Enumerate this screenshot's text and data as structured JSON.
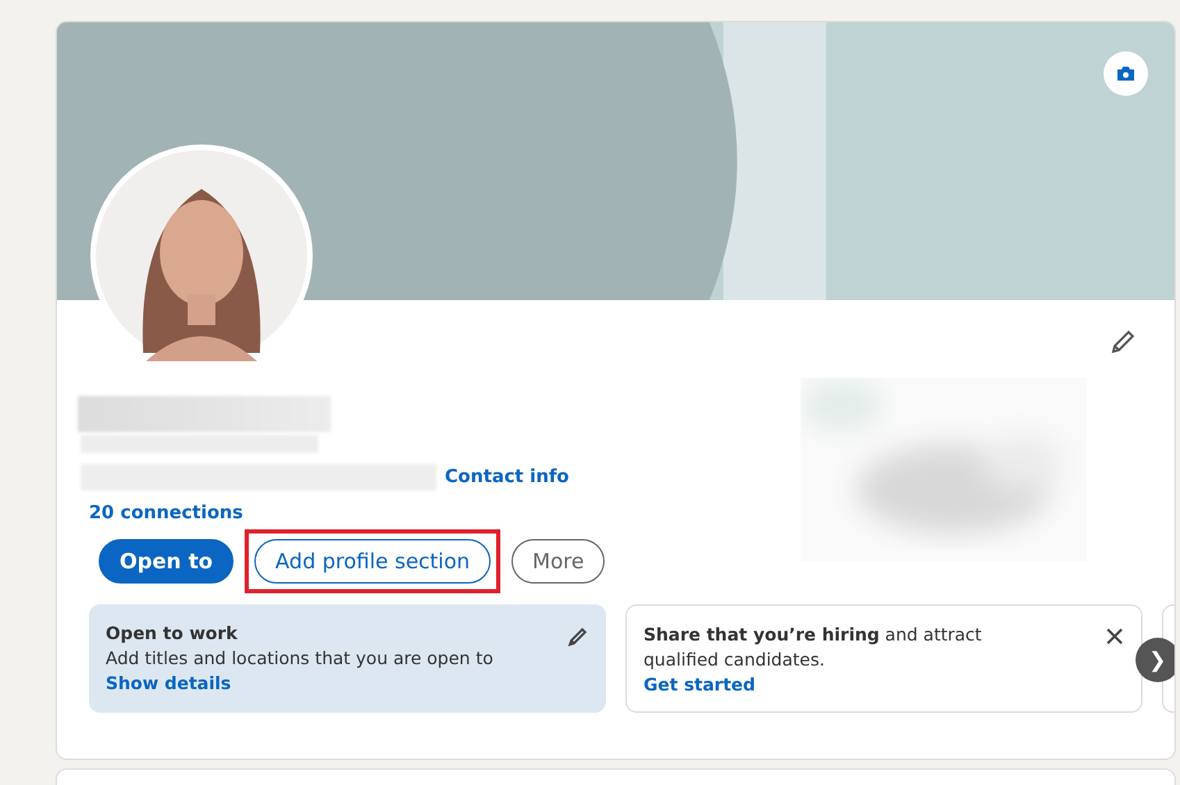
{
  "profile": {
    "contact_link": "Contact info",
    "connections": "20 connections"
  },
  "buttons": [
    {
      "label": "Open to",
      "kind": "primary",
      "highlighted": false
    },
    {
      "label": "Add profile section",
      "kind": "outline",
      "highlighted": true
    },
    {
      "label": "More",
      "kind": "secondary",
      "highlighted": false
    }
  ],
  "cards": [
    {
      "kind": "open_to_work",
      "title": "Open to work",
      "text": "Add titles and locations that you are open to",
      "link": "Show details"
    },
    {
      "kind": "hiring",
      "text": "**Share that you’re hiring** and attract qualified candidates.",
      "link": "Get started"
    }
  ],
  "carousel_next": "❯"
}
